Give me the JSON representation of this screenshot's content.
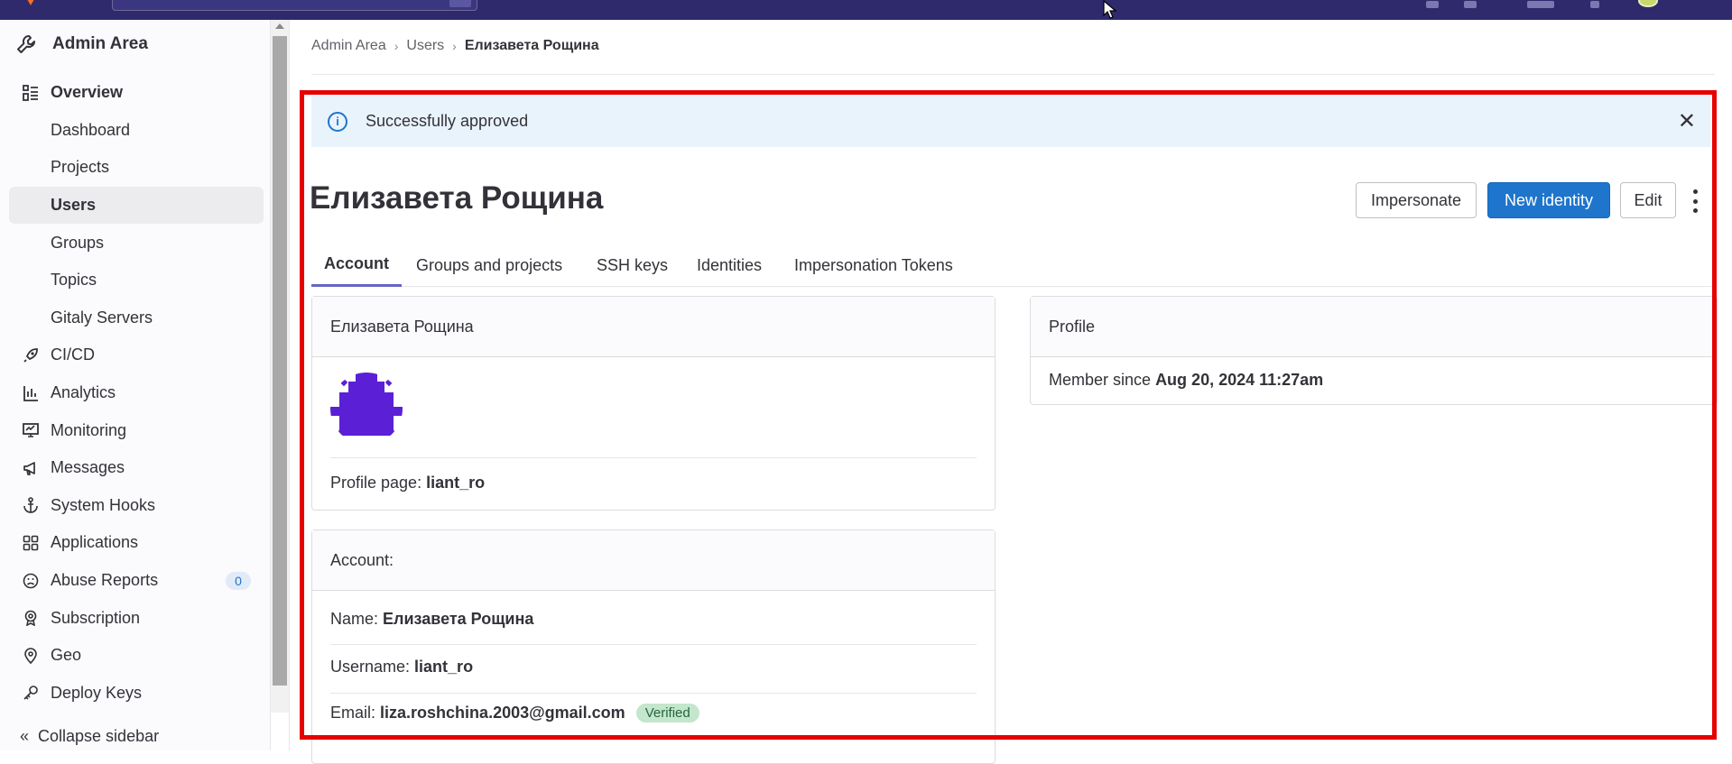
{
  "sidebar": {
    "title": "Admin Area",
    "items": [
      {
        "label": "Overview",
        "icon": "overview-icon",
        "kind": "parent"
      },
      {
        "label": "Dashboard",
        "kind": "sub"
      },
      {
        "label": "Projects",
        "kind": "sub"
      },
      {
        "label": "Users",
        "kind": "sub",
        "active": true
      },
      {
        "label": "Groups",
        "kind": "sub"
      },
      {
        "label": "Topics",
        "kind": "sub"
      },
      {
        "label": "Gitaly Servers",
        "kind": "sub"
      },
      {
        "label": "CI/CD",
        "icon": "rocket-icon"
      },
      {
        "label": "Analytics",
        "icon": "chart-icon"
      },
      {
        "label": "Monitoring",
        "icon": "monitor-icon"
      },
      {
        "label": "Messages",
        "icon": "megaphone-icon"
      },
      {
        "label": "System Hooks",
        "icon": "anchor-icon"
      },
      {
        "label": "Applications",
        "icon": "applications-icon"
      },
      {
        "label": "Abuse Reports",
        "icon": "abuse-icon",
        "badge": "0"
      },
      {
        "label": "Subscription",
        "icon": "subscription-icon"
      },
      {
        "label": "Geo",
        "icon": "geo-icon"
      },
      {
        "label": "Deploy Keys",
        "icon": "key-icon"
      }
    ],
    "collapse_label": "Collapse sidebar"
  },
  "breadcrumb": [
    "Admin Area",
    "Users",
    "Елизавета Рощина"
  ],
  "alert": {
    "text": "Successfully approved"
  },
  "page": {
    "title": "Елизавета Рощина"
  },
  "actions": {
    "impersonate": "Impersonate",
    "new_identity": "New identity",
    "edit": "Edit"
  },
  "tabs": [
    "Account",
    "Groups and projects",
    "SSH keys",
    "Identities",
    "Impersonation Tokens"
  ],
  "user_card": {
    "header": "Елизавета Рощина",
    "profile_page_label": "Profile page:",
    "profile_page_value": "liant_ro"
  },
  "account_card": {
    "header": "Account:",
    "name_label": "Name:",
    "name_value": "Елизавета Рощина",
    "username_label": "Username:",
    "username_value": "liant_ro",
    "email_label": "Email:",
    "email_value": "liza.roshchina.2003@gmail.com",
    "email_badge": "Verified"
  },
  "profile_card": {
    "header": "Profile",
    "member_since_label": "Member since",
    "member_since_value": "Aug 20, 2024 11:27am"
  },
  "colors": {
    "accent": "#1f75cb",
    "topbar": "#2f2a6b",
    "avatar": "#5b1fd6",
    "highlight": "#e60000"
  }
}
